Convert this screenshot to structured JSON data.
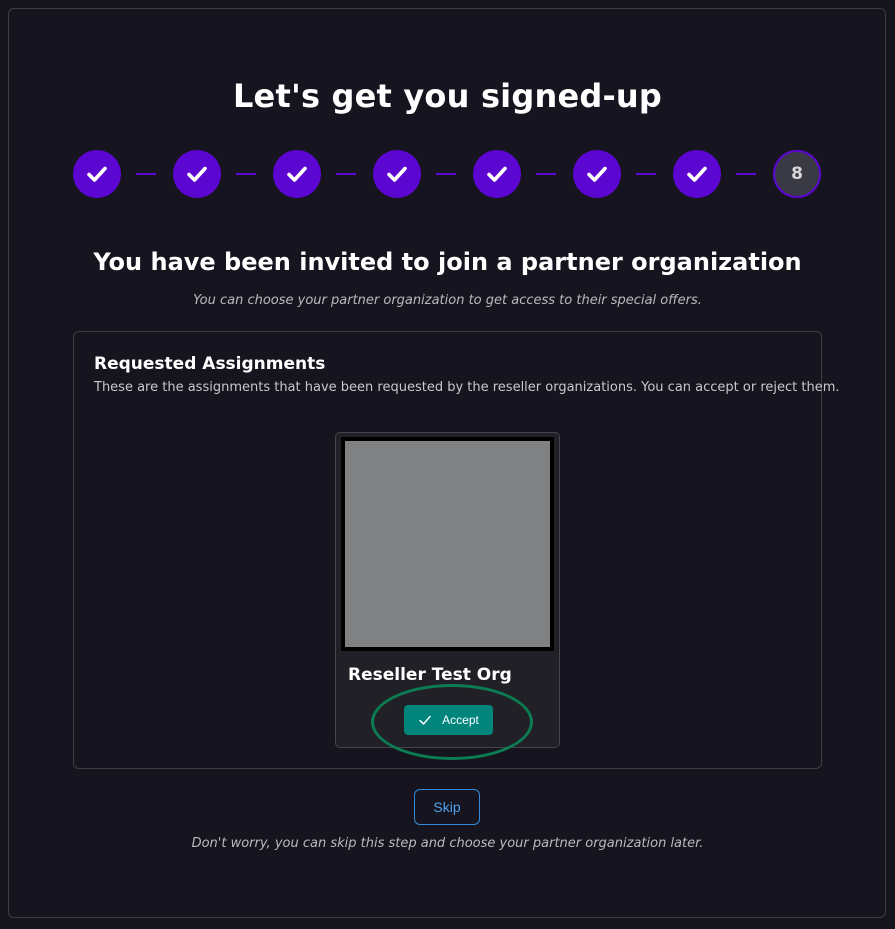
{
  "page": {
    "title": "Let's get you signed-up"
  },
  "stepper": {
    "completed_steps": 7,
    "current_step_label": "8",
    "accent_color": "#5b06d1",
    "completed_icon": "check-icon"
  },
  "section": {
    "title": "You have been invited to join a partner organization",
    "subtitle": "You can choose your partner organization to get access to their special offers."
  },
  "assignments": {
    "title": "Requested Assignments",
    "description": "These are the assignments that have been requested by the reseller organizations. You can accept or reject them.",
    "items": [
      {
        "name": "Reseller Test Org",
        "accept_label": "Accept",
        "accept_icon": "check-icon"
      }
    ]
  },
  "actions": {
    "skip_label": "Skip",
    "skip_note": "Don't worry, you can skip this step and choose your partner organization later."
  },
  "colors": {
    "background": "#16151d",
    "accept": "#00857d",
    "skip": "#4ea3ec",
    "highlight": "#0c7c52"
  }
}
